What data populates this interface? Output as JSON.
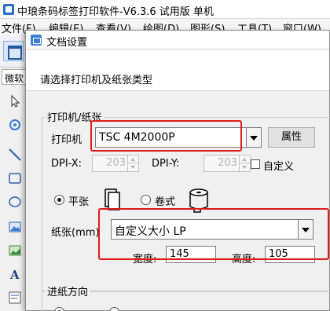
{
  "app": {
    "title": "中琅条码标签打印软件-V6.3.6 试用版 单机",
    "menus": [
      "文件(F)",
      "编辑(E)",
      "查看(V)",
      "绘图(D)",
      "图形(S)",
      "工具(T)",
      "窗口(W)"
    ],
    "zoom_combo": "微软"
  },
  "dialog": {
    "title": "文档设置",
    "instruction": "请选择打印机及纸张类型",
    "printer_group": {
      "title": "打印机/纸张",
      "printer_label": "打印机",
      "printer_value": "TSC 4M2000P",
      "properties_button": "属性",
      "dpi_x_label": "DPI-X:",
      "dpi_x_value": "203",
      "dpi_y_label": "DPI-Y:",
      "dpi_y_value": "203",
      "custom_dpi_label": "自定义",
      "paper_type_sheet": "平张",
      "paper_type_roll": "卷式",
      "paper_label": "纸张(mm)",
      "paper_value": "自定义大小 LP",
      "width_label": "宽度:",
      "width_value": "145",
      "height_label": "高度:",
      "height_value": "105"
    },
    "feed_group": {
      "title": "进纸方向"
    }
  },
  "colors": {
    "highlight_red": "#e11b1b",
    "dialog_bg": "#f0f0f0"
  }
}
